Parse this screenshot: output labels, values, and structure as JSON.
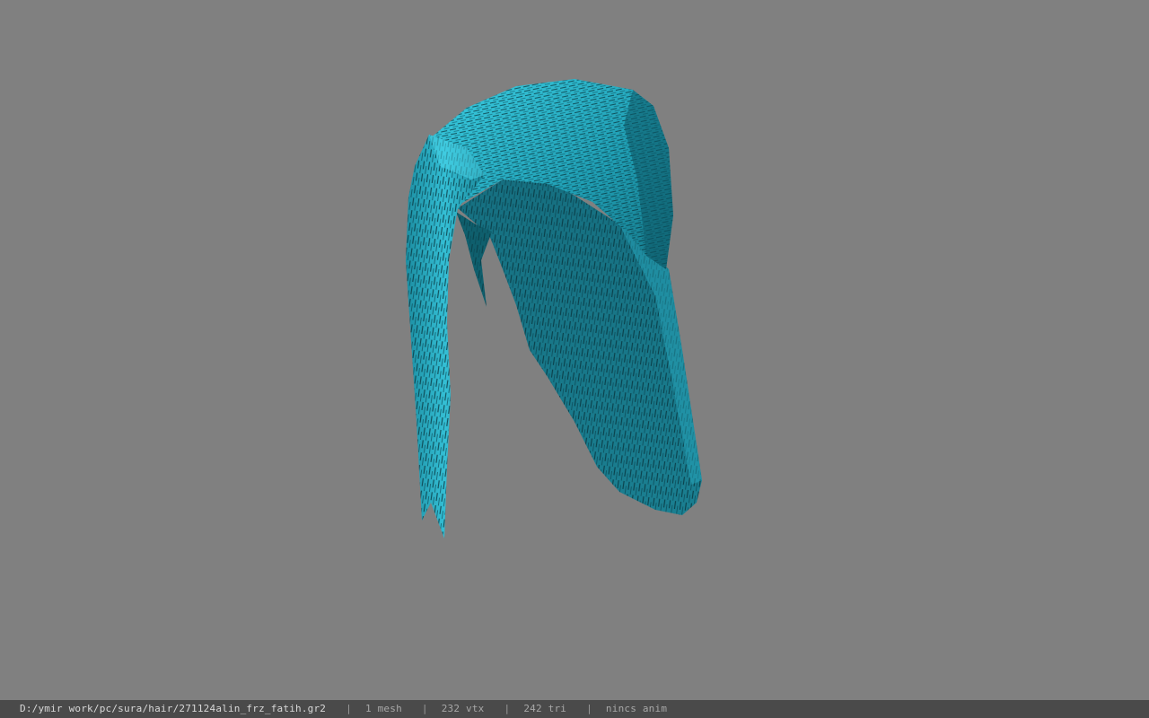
{
  "viewer": {
    "background_color": "#808080",
    "model": {
      "name": "hair-model",
      "base_color": "#1f8fa3",
      "highlight_color": "#37c6dc",
      "shadow_color": "#0c4a56"
    }
  },
  "status_bar": {
    "file_path": "D:/ymir work/pc/sura/hair/271124alin_frz_fatih.gr2",
    "separator": "|",
    "mesh_count": "1 mesh",
    "vertex_count": "232 vtx",
    "triangle_count": "242 tri",
    "animation": "nincs anim"
  }
}
